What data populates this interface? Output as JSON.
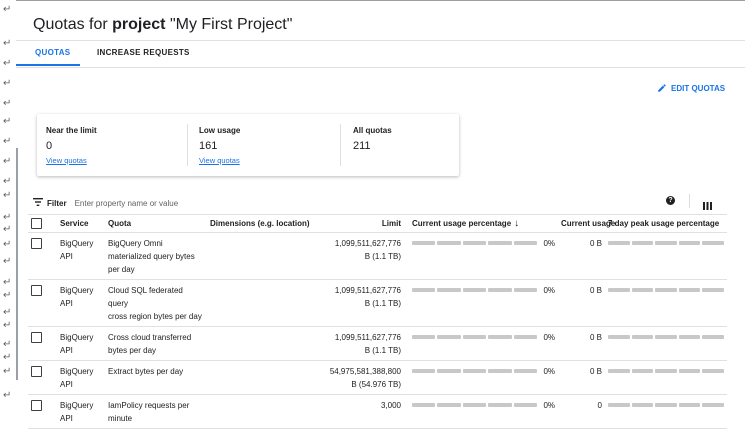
{
  "page": {
    "title_prefix": "Quotas for ",
    "title_bold": "project",
    "title_suffix": " \"My First Project\""
  },
  "tabs": [
    {
      "label": "QUOTAS",
      "active": true
    },
    {
      "label": "INCREASE REQUESTS",
      "active": false
    }
  ],
  "edit_quotas_label": "EDIT QUOTAS",
  "summary": [
    {
      "label": "Near the limit",
      "value": "0",
      "link": "View quotas"
    },
    {
      "label": "Low usage",
      "value": "161",
      "link": "View quotas"
    },
    {
      "label": "All quotas",
      "value": "211",
      "link": ""
    }
  ],
  "filter": {
    "label": "Filter",
    "placeholder": "Enter property name or value"
  },
  "columns": {
    "service": "Service",
    "quota": "Quota",
    "dimensions": "Dimensions (e.g. location)",
    "limit": "Limit",
    "current_pct": "Current usage percentage",
    "current_usage": "Current usage",
    "peak": "7 day peak usage percentage"
  },
  "rows": [
    {
      "service": [
        "BigQuery",
        "API"
      ],
      "quota": [
        "BigQuery Omni",
        "materialized query bytes",
        "per day"
      ],
      "dimensions": "",
      "limit": [
        "1,099,511,627,776",
        "B (1.1 TB)"
      ],
      "current_pct": "0%",
      "current_usage": "0 B"
    },
    {
      "service": [
        "BigQuery",
        "API"
      ],
      "quota": [
        "Cloud SQL federated query",
        "cross region bytes per day"
      ],
      "dimensions": "",
      "limit": [
        "1,099,511,627,776",
        "B (1.1 TB)"
      ],
      "current_pct": "0%",
      "current_usage": "0 B"
    },
    {
      "service": [
        "BigQuery",
        "API"
      ],
      "quota": [
        "Cross cloud transferred",
        "bytes per day"
      ],
      "dimensions": "",
      "limit": [
        "1,099,511,627,776",
        "B (1.1 TB)"
      ],
      "current_pct": "0%",
      "current_usage": "0 B"
    },
    {
      "service": [
        "BigQuery",
        "API"
      ],
      "quota": [
        "Extract bytes per day"
      ],
      "dimensions": "",
      "limit": [
        "54,975,581,388,800",
        "B (54.976 TB)"
      ],
      "current_pct": "0%",
      "current_usage": "0 B"
    },
    {
      "service": [
        "BigQuery",
        "API"
      ],
      "quota": [
        "IamPolicy requests per",
        "minute"
      ],
      "dimensions": "",
      "limit": [
        "3,000"
      ],
      "current_pct": "0%",
      "current_usage": "0"
    }
  ],
  "icons": {
    "edit": "pencil-icon",
    "filter": "filter-icon",
    "help": "help-icon",
    "columns": "column-display-icon",
    "sort": "arrow-down-icon",
    "return_mark": "↵"
  },
  "colors": {
    "accent": "#1a73e8",
    "bar": "#c8c8c8"
  }
}
